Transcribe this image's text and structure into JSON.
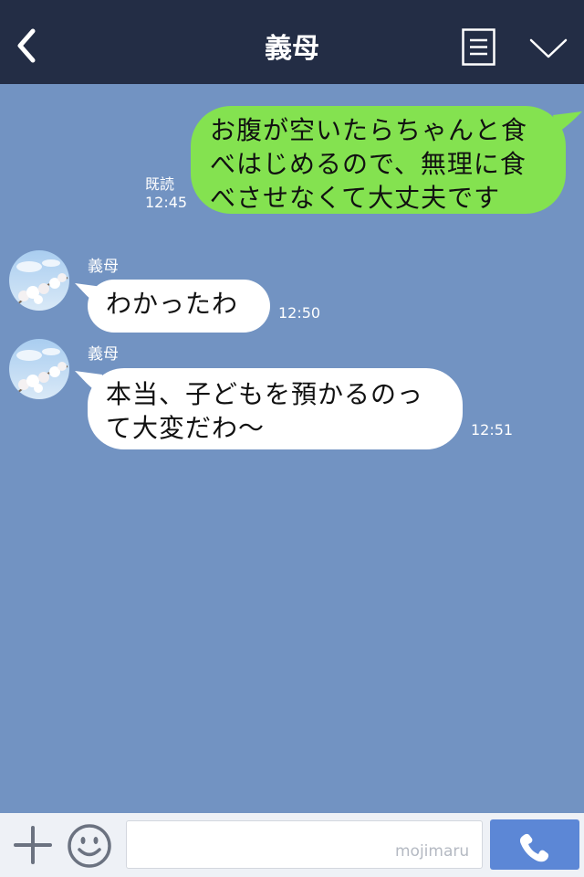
{
  "header": {
    "title": "義母",
    "back_icon": "chevron-left-icon",
    "menu_icon": "list-icon",
    "collapse_icon": "chevron-down-icon"
  },
  "messages": [
    {
      "direction": "outgoing",
      "lines": [
        "お腹が空いたらちゃんと食",
        "べはじめるので、無理に食",
        "べさせなくて大丈夫です"
      ],
      "read_label": "既読",
      "time": "12:45"
    },
    {
      "direction": "incoming",
      "sender": "義母",
      "lines": [
        "わかったわ"
      ],
      "time": "12:50"
    },
    {
      "direction": "incoming",
      "sender": "義母",
      "lines": [
        "本当、子どもを預かるのっ",
        "て大変だわ〜"
      ],
      "time": "12:51"
    }
  ],
  "input_bar": {
    "plus_icon": "plus-icon",
    "emoji_icon": "smiley-icon",
    "placeholder": "",
    "watermark": "mojimaru",
    "call_icon": "phone-icon"
  },
  "colors": {
    "header_bg": "#232d45",
    "chat_bg": "#7293c2",
    "outgoing_bubble": "#84e250",
    "incoming_bubble": "#ffffff",
    "call_button": "#5c87d6"
  }
}
